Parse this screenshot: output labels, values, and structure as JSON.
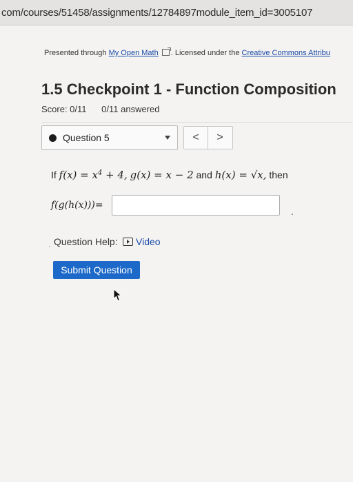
{
  "browser": {
    "url": "com/courses/51458/assignments/12784897module_item_id=3005107"
  },
  "header": {
    "presented_prefix": "Presented through",
    "presented_link": "My Open Math",
    "licensed_text": ". Licensed under the",
    "license_link": "Creative Commons Attribu"
  },
  "assignment": {
    "title": "1.5 Checkpoint 1 - Function Composition",
    "score": "Score: 0/11",
    "answered": "0/11 answered"
  },
  "question_nav": {
    "selected": "Question 5",
    "prev_symbol": "<",
    "next_symbol": ">"
  },
  "problem": {
    "if_word": "If",
    "f_def": "f(x) = x",
    "exponent": "4",
    "f_def_tail": " + 4,",
    "g_def": "g(x) = x − 2",
    "and_word": "and",
    "h_def": "h(x) = √x,",
    "then_word": "then",
    "prompt": "f(g(h(x)))=",
    "answer_value": "",
    "period": "."
  },
  "help": {
    "label": "Question Help:",
    "video_label": "Video",
    "bullet": "·"
  },
  "actions": {
    "submit_label": "Submit Question"
  }
}
